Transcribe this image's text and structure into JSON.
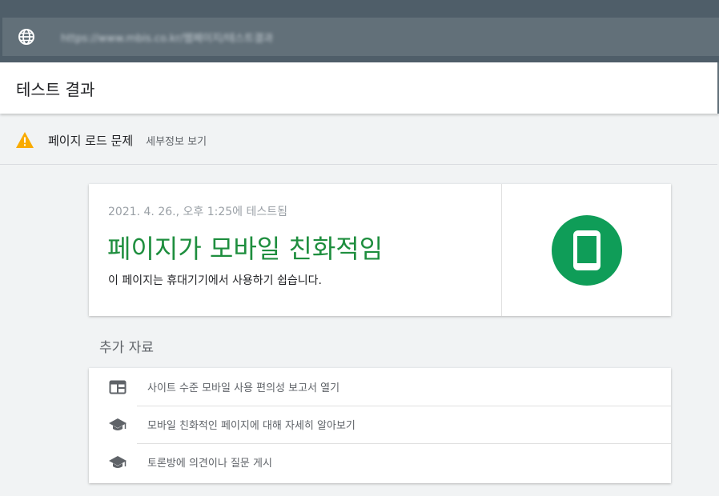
{
  "browser": {
    "url": "https://www.mbis.co.kr/웹페이지/테스트결과",
    "globe_icon": "globe-icon"
  },
  "header": {
    "title": "테스트 결과"
  },
  "warning": {
    "icon": "warning-icon",
    "text": "페이지 로드 문제",
    "details_link": "세부정보 보기",
    "color": "#f9ab00"
  },
  "result_card": {
    "tested_at": "2021. 4. 26., 오후 1:25에 테스트됨",
    "result": "페이지가 모바일 친화적임",
    "description": "이 페이지는 휴대기기에서 사용하기 쉽습니다.",
    "icon": "mobile-phone-icon",
    "accent_color": "#0f9d58"
  },
  "resources": {
    "title": "추가 자료",
    "items": [
      {
        "label": "사이트 수준 모바일 사용 편의성 보고서 열기",
        "icon": "report-icon"
      },
      {
        "label": "모바일 친화적인 페이지에 대해 자세히 알아보기",
        "icon": "graduation-cap-icon"
      },
      {
        "label": "토론방에 의견이나 질문 게시",
        "icon": "graduation-cap-icon"
      }
    ]
  }
}
